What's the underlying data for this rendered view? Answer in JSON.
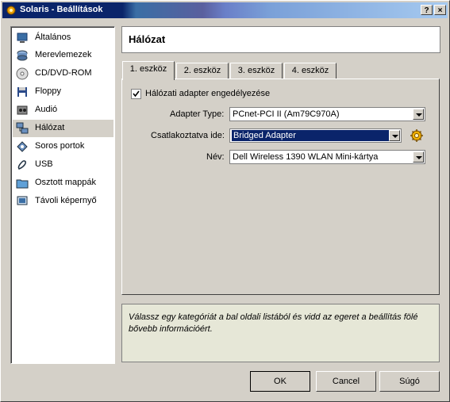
{
  "window": {
    "title": "Solaris - Beállítások"
  },
  "titlebar_buttons": {
    "help": "?",
    "close": "×"
  },
  "sidebar": {
    "items": [
      {
        "label": "Általános",
        "icon": "general-icon"
      },
      {
        "label": "Merevlemezek",
        "icon": "harddisk-icon"
      },
      {
        "label": "CD/DVD-ROM",
        "icon": "cd-icon"
      },
      {
        "label": "Floppy",
        "icon": "floppy-icon"
      },
      {
        "label": "Audió",
        "icon": "audio-icon"
      },
      {
        "label": "Hálózat",
        "icon": "network-icon",
        "selected": true
      },
      {
        "label": "Soros portok",
        "icon": "serial-icon"
      },
      {
        "label": "USB",
        "icon": "usb-icon"
      },
      {
        "label": "Osztott mappák",
        "icon": "folder-icon"
      },
      {
        "label": "Távoli képernyő",
        "icon": "remote-display-icon"
      }
    ]
  },
  "header": {
    "title": "Hálózat"
  },
  "tabs": [
    {
      "label": "1. eszköz",
      "active": true
    },
    {
      "label": "2. eszköz"
    },
    {
      "label": "3. eszköz"
    },
    {
      "label": "4. eszköz"
    }
  ],
  "network": {
    "enable_label": "Hálózati adapter engedélyezése",
    "enabled": true,
    "adapter_type_label": "Adapter Type:",
    "adapter_type_value": "PCnet-PCI II (Am79C970A)",
    "attached_label": "Csatlakoztatva ide:",
    "attached_value": "Bridged Adapter",
    "name_label": "Név:",
    "name_value": "Dell Wireless 1390 WLAN Mini-kártya"
  },
  "info": {
    "text": "Válassz egy kategóriát a bal oldali listából és vidd az egeret a beállítás fölé bővebb információért."
  },
  "buttons": {
    "ok": "OK",
    "cancel": "Cancel",
    "help": "Súgó"
  },
  "colors": {
    "selection": "#0a246a",
    "info_bg": "#e6e7d7",
    "face": "#d4d0c8"
  }
}
